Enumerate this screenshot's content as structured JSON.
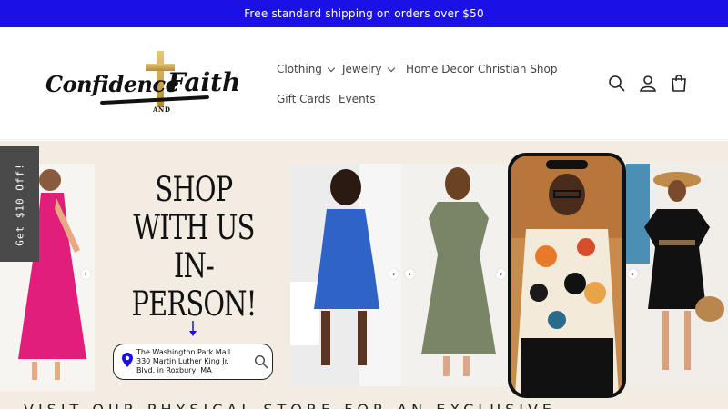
{
  "announcement": "Free standard shipping on orders over $50",
  "logo": {
    "word1": "Confidence",
    "word2": "Faith",
    "and": "AND"
  },
  "nav": {
    "clothing": "Clothing",
    "jewelry": "Jewelry",
    "home_decor": "Home Decor",
    "christian_shop": "Christian Shop",
    "gift_cards": "Gift Cards",
    "events": "Events"
  },
  "hero": {
    "shop_title": [
      "SHOP",
      "WITH US",
      "IN-PERSON!"
    ],
    "address": [
      "The Washington Park Mall",
      "330 Martin Luther King Jr.",
      "Blvd. in Roxbury, MA"
    ],
    "visit_text": "VISIT OUR PHYSICAL STORE FOR AN EXCLUSIVE"
  },
  "discount_tab": "Get $10 Off!",
  "colors": {
    "announcement_bg": "#1b10e6",
    "hero_bg": "#f3ece2",
    "tab_bg": "#4a4a4a"
  },
  "icons": [
    "search-icon",
    "account-icon",
    "cart-icon",
    "location-pin-icon",
    "chevron-right-icon",
    "chevron-left-icon"
  ]
}
